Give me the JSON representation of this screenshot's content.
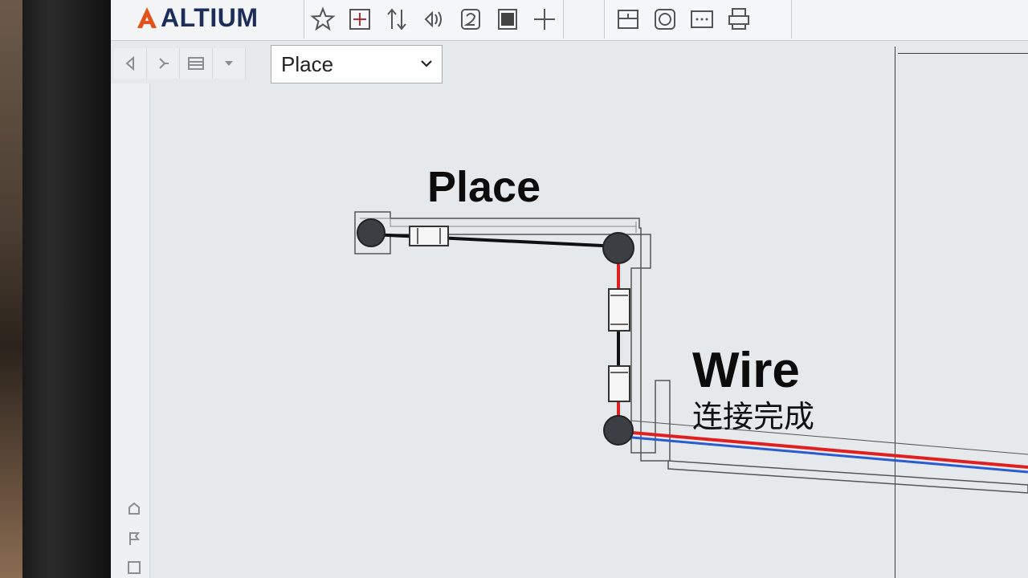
{
  "app": {
    "logo_text": "ALTIUM",
    "brand_color": "#1d2d5a",
    "accent_color": "#e2531a"
  },
  "toolbar": {
    "group1": [
      {
        "icon": "star-icon"
      },
      {
        "icon": "place-part-icon"
      },
      {
        "icon": "sort-arrows-icon"
      },
      {
        "icon": "signal-icon"
      },
      {
        "icon": "port-icon"
      },
      {
        "icon": "sheet-icon"
      },
      {
        "icon": "crosshair-plus-icon"
      }
    ],
    "group2": [
      {
        "icon": "bus-icon"
      },
      {
        "icon": "circle-target-icon"
      },
      {
        "icon": "more-icon"
      },
      {
        "icon": "printer-icon"
      }
    ]
  },
  "subtoolbar": {
    "buttons": [
      {
        "icon": "back-arrow-icon"
      },
      {
        "icon": "pin-tool-icon"
      },
      {
        "icon": "list-icon"
      },
      {
        "icon": "dropdown-icon"
      }
    ],
    "mode_select": {
      "value": "Place"
    }
  },
  "canvas": {
    "place_label": "Place",
    "wire_label": "Wire",
    "status_label": "连接完成",
    "wire_colors": {
      "black": "#111111",
      "red": "#e02020",
      "blue": "#2a5cd0"
    }
  },
  "rail": {
    "icons": [
      "home-icon",
      "flag-icon",
      "panel-icon"
    ]
  }
}
